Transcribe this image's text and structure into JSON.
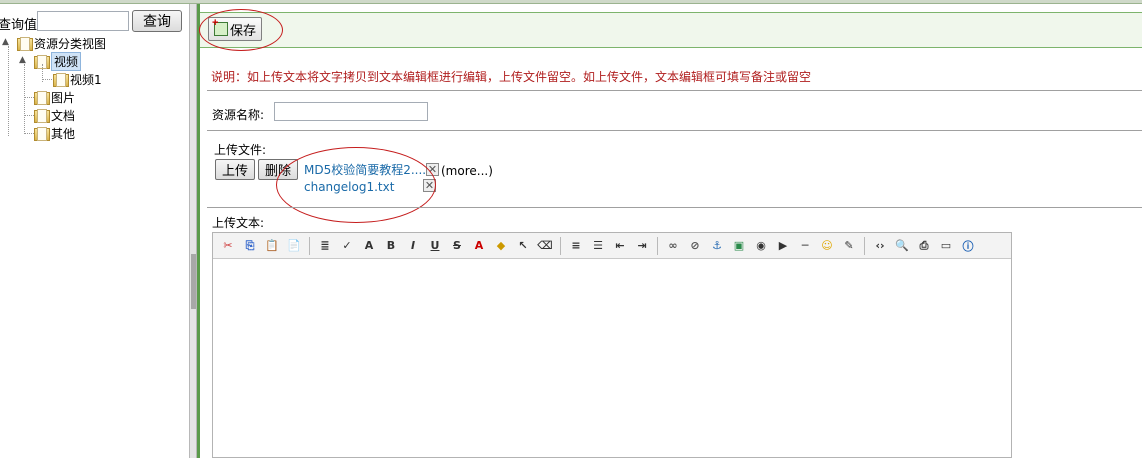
{
  "query": {
    "label": "查询值:",
    "input_value": "",
    "button_label": "查询"
  },
  "tree": {
    "root": "资源分类视图",
    "items": [
      {
        "label": "视频",
        "selected": true
      },
      {
        "label": "视频1"
      },
      {
        "label": "图片"
      },
      {
        "label": "文档"
      },
      {
        "label": "其他"
      }
    ]
  },
  "toolbar": {
    "save_label": "保存"
  },
  "form": {
    "note": "说明：如上传文本将文字拷贝到文本编辑框进行编辑，上传文件留空。如上传文件，文本编辑框可填写备注或留空",
    "resource_name_label": "资源名称:",
    "resource_name_value": "",
    "upload_file_label": "上传文件:",
    "upload_button": "上传",
    "delete_button": "删除",
    "files": [
      "MD5校验简要教程2....",
      "changelog1.txt"
    ],
    "more_label": "(more...)",
    "upload_text_label": "上传文本:"
  },
  "editor_tools": [
    "cut-icon",
    "copy-icon",
    "paste-icon",
    "paste-text-icon",
    "sep",
    "format-icon",
    "spellcheck-icon",
    "font-size-icon",
    "bold-icon",
    "italic-icon",
    "underline-icon",
    "strikethrough-icon",
    "font-color-icon",
    "highlight-icon",
    "select-icon",
    "eraser-icon",
    "sep",
    "align-left-icon",
    "bullet-list-icon",
    "outdent-icon",
    "indent-icon",
    "sep",
    "link-icon",
    "unlink-icon",
    "anchor-icon",
    "image-icon",
    "flash-icon",
    "media-icon",
    "hr-icon",
    "smiley-icon",
    "edit-icon",
    "sep",
    "source-icon",
    "preview-icon",
    "print-icon",
    "fullscreen-icon",
    "about-icon"
  ],
  "editor_glyphs": {
    "cut-icon": "✂",
    "copy-icon": "⎘",
    "paste-icon": "📋",
    "paste-text-icon": "📄",
    "format-icon": "≣",
    "spellcheck-icon": "✓",
    "font-size-icon": "A",
    "bold-icon": "B",
    "italic-icon": "I",
    "underline-icon": "U",
    "strikethrough-icon": "S",
    "font-color-icon": "A",
    "highlight-icon": "◆",
    "select-icon": "↖",
    "eraser-icon": "⌫",
    "align-left-icon": "≡",
    "bullet-list-icon": "☰",
    "outdent-icon": "⇤",
    "indent-icon": "⇥",
    "link-icon": "∞",
    "unlink-icon": "⊘",
    "anchor-icon": "⚓",
    "image-icon": "▣",
    "flash-icon": "◉",
    "media-icon": "▶",
    "hr-icon": "─",
    "smiley-icon": "☺",
    "edit-icon": "✎",
    "source-icon": "‹›",
    "preview-icon": "🔍",
    "print-icon": "⎙",
    "fullscreen-icon": "▭",
    "about-icon": "ⓘ"
  },
  "annotation_color": "#c51d1d",
  "note_color": "#b01e1e",
  "link_color": "#1a6aa8"
}
